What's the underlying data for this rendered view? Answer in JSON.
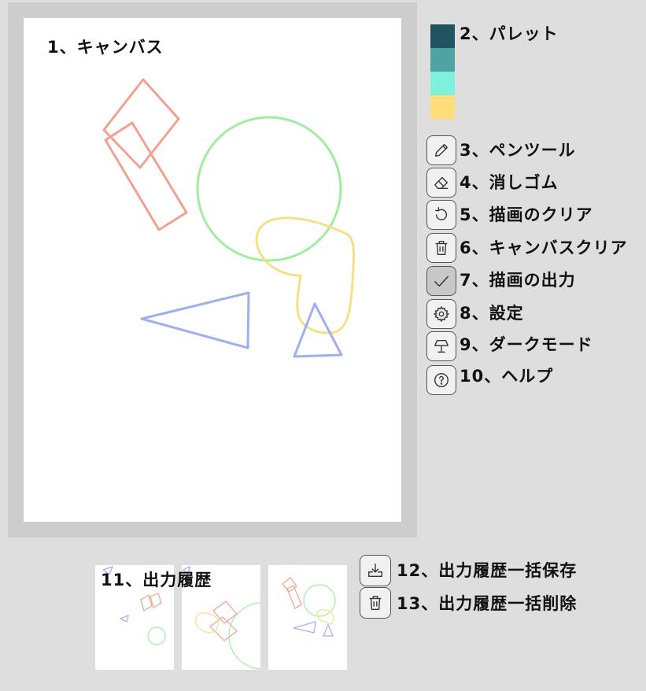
{
  "canvas": {
    "label": "1、キャンバス"
  },
  "palette": {
    "label": "2、パレット",
    "colors": [
      "#1f5460",
      "#4fa3a3",
      "#7ff0dc",
      "#ffdd78"
    ]
  },
  "tools": [
    {
      "label": "3、ペンツール",
      "icon": "pencil-icon"
    },
    {
      "label": "4、消しゴム",
      "icon": "eraser-icon"
    },
    {
      "label": "5、描画のクリア",
      "icon": "undo-icon"
    },
    {
      "label": "6、キャンバスクリア",
      "icon": "trash-icon"
    },
    {
      "label": "7、描画の出力",
      "icon": "check-icon",
      "active": true
    },
    {
      "label": "8、設定",
      "icon": "gear-icon"
    },
    {
      "label": "9、ダークモード",
      "icon": "lamp-icon"
    },
    {
      "label": "10、ヘルプ",
      "icon": "help-icon"
    }
  ],
  "history": {
    "label": "11、出力履歴",
    "save_all_label": "12、出力履歴一括保存",
    "delete_all_label": "13、出力履歴一括削除"
  },
  "stroke_colors": {
    "red": "#f4a090",
    "green": "#a0eca0",
    "yellow": "#f7df88",
    "blue": "#a0aef0"
  }
}
